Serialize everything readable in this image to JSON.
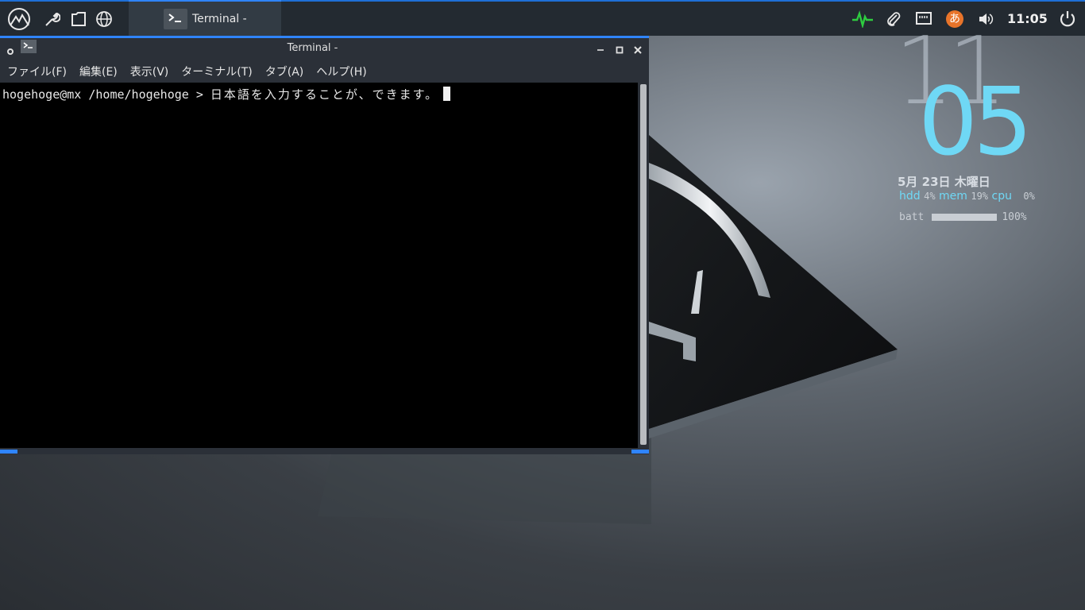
{
  "panel": {
    "task_label": "Terminal -",
    "clock": "11:05",
    "ime_label": "あ"
  },
  "window": {
    "title": "Terminal -",
    "menu": [
      "ファイル(F)",
      "編集(E)",
      "表示(V)",
      "ターミナル(T)",
      "タブ(A)",
      "ヘルプ(H)"
    ],
    "prompt": "hogehoge@mx /home/hogehoge > ",
    "input": "日本語を入力することが、できます。"
  },
  "conky": {
    "hour": "11",
    "minute": "05",
    "date": "5月 23日 木曜日",
    "hdd_label": "hdd",
    "hdd_value": "4%",
    "mem_label": "mem",
    "mem_value": "19%",
    "cpu_label": "cpu",
    "cpu_value": "0%",
    "batt_label": "batt",
    "batt_value": "100%",
    "batt_fraction": 1.0
  },
  "colors": {
    "accent": "#2f84ff",
    "conky": "#6fd8f5",
    "activity": "#2ecc40"
  }
}
